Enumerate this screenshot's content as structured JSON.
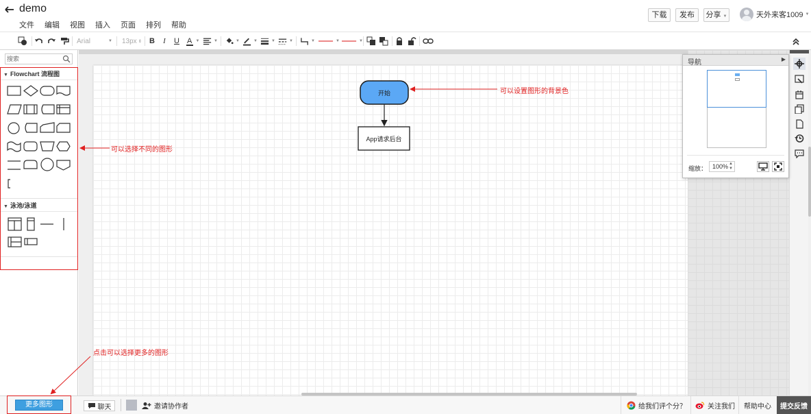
{
  "header": {
    "doc_title": "demo",
    "menu": [
      "文件",
      "编辑",
      "视图",
      "插入",
      "页面",
      "排列",
      "帮助"
    ],
    "buttons": {
      "download": "下载",
      "publish": "发布",
      "share": "分享"
    },
    "username": "天外来客1009"
  },
  "toolbar": {
    "font_family": "Arial",
    "font_size": "13px",
    "icons": [
      "style-icon",
      "undo-icon",
      "redo-icon",
      "format-painter-icon",
      "bold-icon",
      "italic-icon",
      "underline-icon",
      "font-color-icon",
      "align-icon",
      "fill-color-icon",
      "line-color-icon",
      "line-width-icon",
      "line-style-icon",
      "connector-icon",
      "line-start-icon",
      "line-end-icon",
      "bring-front-icon",
      "send-back-icon",
      "lock-icon",
      "unlock-icon",
      "group-icon",
      "collapse-icon"
    ]
  },
  "left_panel": {
    "search_placeholder": "搜索",
    "libraries": [
      {
        "title": "Flowchart 流程图"
      },
      {
        "title": "泳池/泳道"
      }
    ],
    "more_shapes": "更多图形"
  },
  "diagram": {
    "nodes": [
      {
        "label": "开始",
        "shape": "rounded-terminator",
        "fill": "#5ba8f5"
      },
      {
        "label": "App请求后台",
        "shape": "rectangle",
        "fill": "#ffffff"
      }
    ],
    "annotations": [
      {
        "text": "可以设置图形的背景色"
      },
      {
        "text": "可以选择不同的图形"
      },
      {
        "text": "点击可以选择更多的图形"
      }
    ],
    "annotation_color": "#e02020"
  },
  "navigator": {
    "title": "导航",
    "zoom_label": "缩放：",
    "zoom_value": "100%"
  },
  "right_strip_icons": [
    "crosshair-icon",
    "shape-format-icon",
    "page-setup-icon",
    "copy-icon",
    "page-icon",
    "history-icon",
    "comment-icon"
  ],
  "bottom_bar": {
    "chat": "聊天",
    "invite": "邀请协作者",
    "rate": "给我们评个分？",
    "follow": "关注我们",
    "help": "帮助中心",
    "feedback": "提交反馈"
  },
  "colors": {
    "accent": "#3e9fe0",
    "annotation": "#e02020",
    "node_start_fill": "#5ba8f5"
  }
}
